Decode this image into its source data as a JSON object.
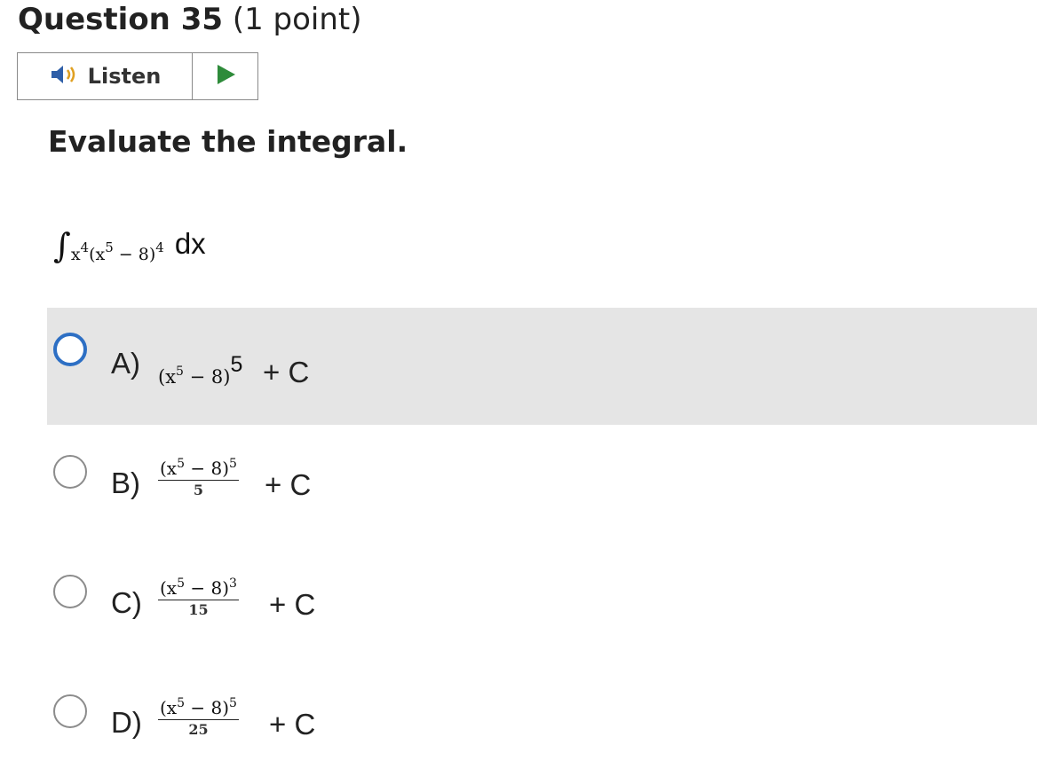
{
  "question": {
    "number": "Question 35",
    "points": "(1 point)"
  },
  "listen": {
    "label": "Listen",
    "speaker_icon": "speaker-icon",
    "play_icon": "play-icon",
    "play_color": "#2e8b3a"
  },
  "prompt": "Evaluate the integral.",
  "integral": {
    "sign": "∫",
    "x": "x",
    "x_exp": "4",
    "base_open": "(x",
    "inner_exp": "5",
    "inner_rest": " − 8)",
    "outer_exp": "4",
    "differential": "dx"
  },
  "options": [
    {
      "letter": "A)",
      "base": "(x",
      "inner_exp": "5",
      "rest": " − 8)",
      "exp": "5",
      "denominator": "",
      "tail": "+ C",
      "selected": false,
      "highlighted": true
    },
    {
      "letter": "B)",
      "base": "(x",
      "inner_exp": "5",
      "rest": " − 8)",
      "exp": "5",
      "denominator": "5",
      "tail": "+ C",
      "selected": false,
      "highlighted": false
    },
    {
      "letter": "C)",
      "base": "(x",
      "inner_exp": "5",
      "rest": " − 8)",
      "exp": "3",
      "denominator": "15",
      "tail": "+ C",
      "selected": false,
      "highlighted": false
    },
    {
      "letter": "D)",
      "base": "(x",
      "inner_exp": "5",
      "rest": " − 8)",
      "exp": "5",
      "denominator": "25",
      "tail": "+ C",
      "selected": false,
      "highlighted": false
    }
  ],
  "colors": {
    "highlight_bg": "#e5e5e5",
    "focus_ring": "#2d6fc4",
    "radio_border": "#8c8c8c"
  }
}
